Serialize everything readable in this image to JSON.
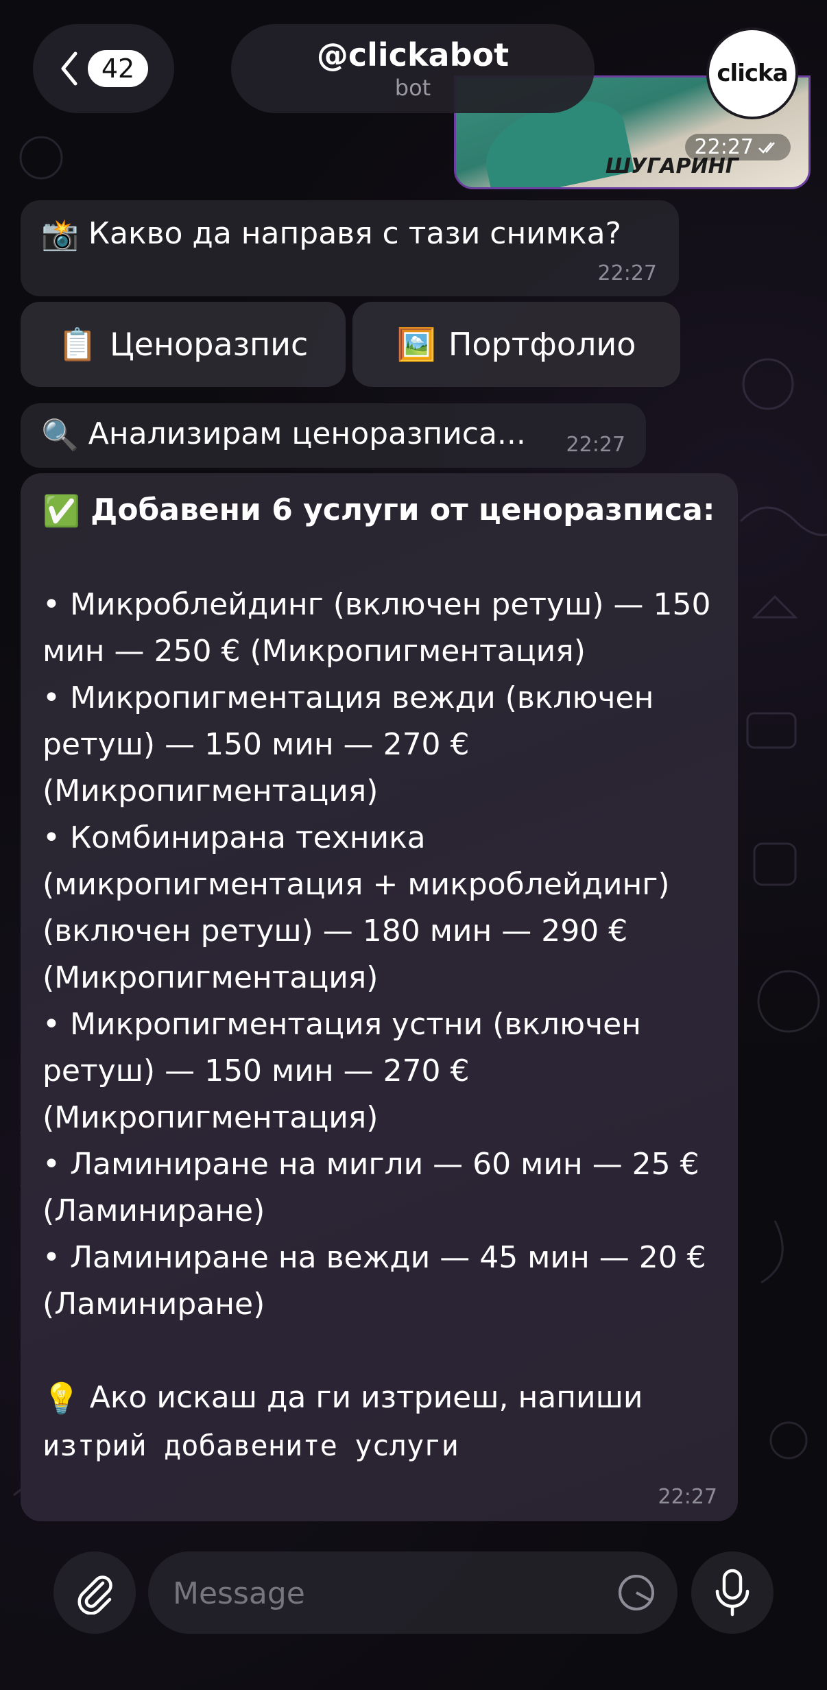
{
  "header": {
    "back_count": "42",
    "title": "@clickabot",
    "subtitle": "bot",
    "avatar_text": "clicka"
  },
  "photo_message": {
    "caption": "ШУГАРИНГ",
    "time": "22:27",
    "read_status": "double-check-icon"
  },
  "messages": {
    "question": {
      "emoji": "📸",
      "text": "Какво да направя с тази снимка?",
      "time": "22:27"
    },
    "buttons": [
      {
        "emoji": "📋",
        "label": "Ценоразпис"
      },
      {
        "emoji": "🖼️",
        "label": "Портфолио"
      }
    ],
    "analyzing": {
      "emoji": "🔍",
      "text": "Анализирам ценоразписа...",
      "time": "22:27"
    },
    "result": {
      "title_emoji": "✅",
      "title": "Добавени 6 услуги от ценоразписа:",
      "services": [
        "• Микроблейдинг (включен ретуш) — 150 мин — 250 € (Микропигментация)",
        "• Микропигментация вежди (включен ретуш) — 150 мин — 270 € (Микропигментация)",
        "• Комбинирана техника (микропигментация + микроблейдинг) (включен ретуш) — 180 мин — 290 € (Микропигментация)",
        "• Микропигментация устни (включен ретуш) — 150 мин — 270 € (Микропигментация)",
        "• Ламиниране на мигли — 60 мин — 25 € (Ламиниране)",
        "• Ламиниране на вежди — 45 мин — 20 € (Ламиниране)"
      ],
      "hint_emoji": "💡",
      "hint_text": "Ако искаш да ги изтриеш, напиши",
      "hint_command": "изтрий добавените услуги",
      "time": "22:27"
    }
  },
  "input": {
    "placeholder": "Message"
  },
  "colors": {
    "background": "#0b0a0d",
    "bubble": "#24222a",
    "accent_border": "#6b3fa0"
  }
}
